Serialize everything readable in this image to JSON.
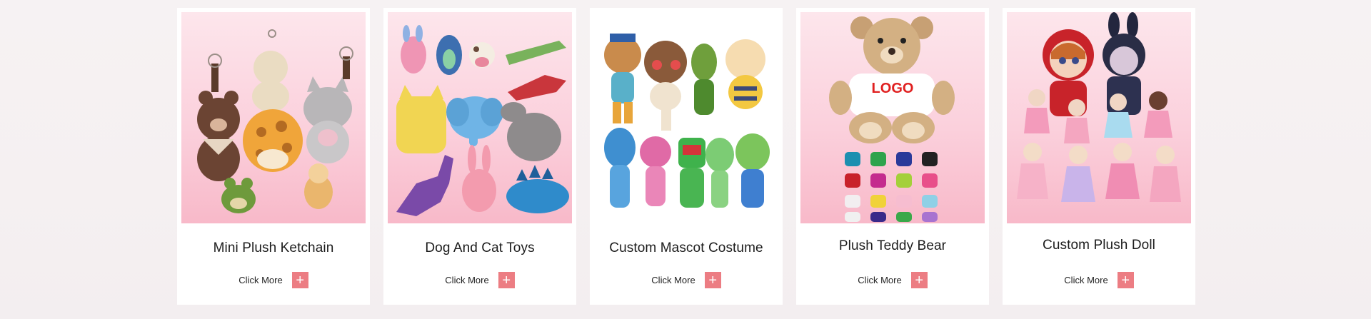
{
  "products": [
    {
      "title": "Mini Plush Ketchain",
      "cta": "Click More",
      "plus": "+",
      "image": "plush-keychains-image",
      "bg": "pink"
    },
    {
      "title": "Dog And Cat Toys",
      "cta": "Click More",
      "plus": "+",
      "image": "pet-toys-image",
      "bg": "pink"
    },
    {
      "title": "Custom Mascot Costume",
      "cta": "Click More",
      "plus": "+",
      "image": "mascot-costumes-image",
      "bg": "white"
    },
    {
      "title": "Plush Teddy Bear",
      "cta": "Click More",
      "plus": "+",
      "image": "teddy-bear-image",
      "bg": "pink",
      "logo_text": "LOGO"
    },
    {
      "title": "Custom Plush Doll",
      "cta": "Click More",
      "plus": "+",
      "image": "plush-dolls-image",
      "bg": "pink"
    }
  ],
  "colors": {
    "accent": "#ec7d83",
    "card_bg": "#ffffff",
    "page_bg": "#f5f0f1",
    "image_pink": "#fbd0dc"
  }
}
